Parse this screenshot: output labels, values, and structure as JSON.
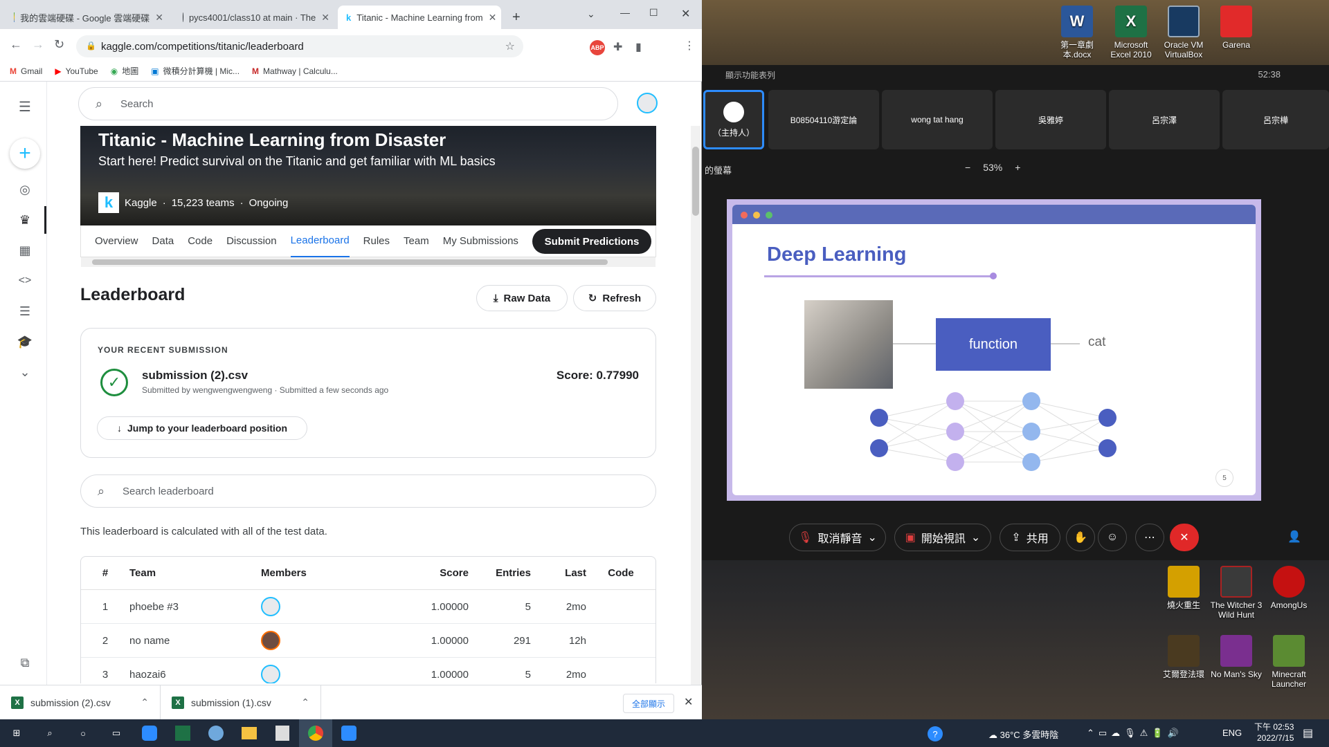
{
  "browser": {
    "tabs": [
      {
        "label": "我的雲端硬碟 - Google 雲端硬碟"
      },
      {
        "label": "pycs4001/class10 at main · The"
      },
      {
        "label": "Titanic - Machine Learning from"
      }
    ],
    "url": "kaggle.com/competitions/titanic/leaderboard",
    "bookmarks": [
      "Gmail",
      "YouTube",
      "地圖",
      "微積分計算機 | Mic...",
      "Mathway | Calculu..."
    ]
  },
  "kaggle": {
    "search_placeholder": "Search",
    "competition": {
      "title": "Titanic - Machine Learning from Disaster",
      "subtitle": "Start here! Predict survival on the Titanic and get familiar with ML basics",
      "host": "Kaggle",
      "teams": "15,223 teams",
      "status": "Ongoing"
    },
    "tabs": [
      "Overview",
      "Data",
      "Code",
      "Discussion",
      "Leaderboard",
      "Rules",
      "Team",
      "My Submissions"
    ],
    "active_tab": "Leaderboard",
    "submit_label": "Submit Predictions",
    "heading": "Leaderboard",
    "raw_data_label": "Raw Data",
    "refresh_label": "Refresh",
    "recent": {
      "label": "YOUR RECENT SUBMISSION",
      "file": "submission (2).csv",
      "submitted_by": "Submitted by wengwengwengweng · Submitted a few seconds ago",
      "score": "Score: 0.77990",
      "jump_label": "Jump to your leaderboard position"
    },
    "lb_search_placeholder": "Search leaderboard",
    "lb_note": "This leaderboard is calculated with all of the test data.",
    "columns": [
      "#",
      "Team",
      "Members",
      "Score",
      "Entries",
      "Last",
      "Code"
    ],
    "rows": [
      {
        "rank": "1",
        "team": "phoebe #3",
        "score": "1.00000",
        "entries": "5",
        "last": "2mo"
      },
      {
        "rank": "2",
        "team": "no name",
        "score": "1.00000",
        "entries": "291",
        "last": "12h"
      },
      {
        "rank": "3",
        "team": "haozai6",
        "score": "1.00000",
        "entries": "5",
        "last": "2mo"
      }
    ]
  },
  "downloads": {
    "items": [
      "submission (2).csv",
      "submission (1).csv"
    ],
    "show_all": "全部顯示"
  },
  "desktop": {
    "top_icons": [
      {
        "label": "第一章劇本.docx"
      },
      {
        "label": "Microsoft Excel 2010"
      },
      {
        "label": "Oracle VM VirtualBox"
      },
      {
        "label": "Garena"
      }
    ],
    "bottom_icons": [
      {
        "label": "燒火重生"
      },
      {
        "label": "The Witcher 3 Wild Hunt"
      },
      {
        "label": "AmongUs"
      },
      {
        "label": "艾爾登法環"
      },
      {
        "label": "No Man's Sky"
      },
      {
        "label": "Minecraft Launcher"
      }
    ]
  },
  "zoom": {
    "view_options": "顯示功能表列",
    "timer": "52:38",
    "host_label": "（主持人）",
    "participants": [
      "B08504110游定論",
      "wong tat hang",
      "吳雅婷",
      "呂宗澤",
      "呂宗樺"
    ],
    "screen_label": "的螢幕",
    "zoom_level": "53%",
    "slide": {
      "title": "Deep Learning",
      "function_label": "function",
      "output_label": "cat",
      "page": "5"
    },
    "controls": {
      "unmute": "取消靜音",
      "start_video": "開始視訊",
      "share": "共用"
    }
  },
  "taskbar": {
    "weather": "36°C 多雲時陰",
    "lang": "ENG",
    "time": "下午 02:53",
    "date": "2022/7/15"
  }
}
